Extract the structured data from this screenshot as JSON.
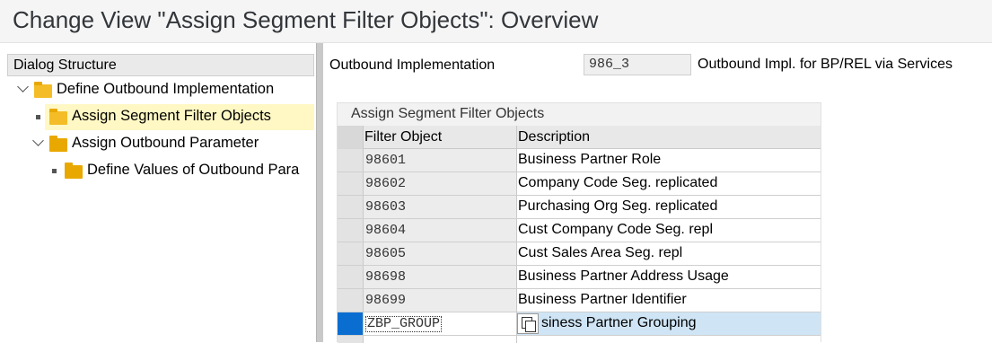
{
  "window": {
    "title": "Change View \"Assign Segment Filter Objects\": Overview"
  },
  "dialog_structure": {
    "header": "Dialog Structure",
    "items": [
      {
        "label": "Define Outbound  Implementation",
        "level": 0,
        "expanded": true
      },
      {
        "label": "Assign Segment Filter Objects",
        "level": 1,
        "selected": true
      },
      {
        "label": "Assign Outbound Parameter",
        "level": 1,
        "expanded": true
      },
      {
        "label": "Define Values of Outbound Para",
        "level": 2
      }
    ]
  },
  "header_fields": {
    "impl_label": "Outbound Implementation",
    "impl_value": "986_3",
    "impl_description": "Outbound Impl. for BP/REL via Services"
  },
  "table": {
    "title": "Assign Segment Filter Objects",
    "columns": [
      "Filter Object",
      "Description"
    ],
    "rows": [
      {
        "filter_object": "98601",
        "description": "Business Partner Role"
      },
      {
        "filter_object": "98602",
        "description": "Company Code Seg. replicated"
      },
      {
        "filter_object": "98603",
        "description": "Purchasing Org Seg. replicated"
      },
      {
        "filter_object": "98604",
        "description": "Cust Company Code Seg. repl"
      },
      {
        "filter_object": "98605",
        "description": "Cust Sales Area Seg. repl"
      },
      {
        "filter_object": "98698",
        "description": "Business Partner Address Usage"
      },
      {
        "filter_object": "98699",
        "description": "Business Partner Identifier"
      },
      {
        "filter_object": "ZBP_GROUP",
        "description": "siness Partner Grouping"
      }
    ]
  },
  "colors": {
    "selection_blue": "#0a6ed1",
    "tree_highlight": "#fff8c4",
    "folder": "#e9a800"
  }
}
